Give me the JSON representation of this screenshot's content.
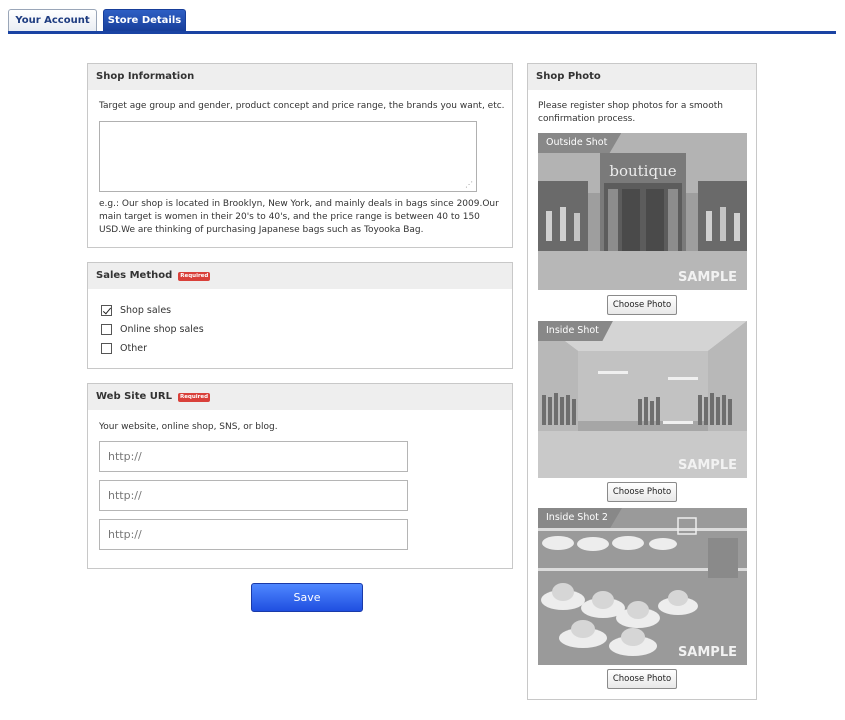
{
  "tabs": {
    "account": "Your Account",
    "store": "Store Details"
  },
  "shop_info": {
    "title": "Shop Information",
    "description": "Target age group and gender, product concept and price range, the brands you want, etc.",
    "textarea_value": "",
    "example": "e.g.: Our shop is located in Brooklyn, New York, and mainly deals in bags since 2009.Our main target is women in their 20's to 40's, and the price range is between 40 to 150 USD.We are thinking of purchasing Japanese bags such as Toyooka Bag."
  },
  "sales_method": {
    "title": "Sales Method",
    "required_badge": "Required",
    "options": [
      {
        "label": "Shop sales",
        "checked": true
      },
      {
        "label": "Online shop sales",
        "checked": false
      },
      {
        "label": "Other",
        "checked": false
      }
    ]
  },
  "website": {
    "title": "Web Site URL",
    "required_badge": "Required",
    "description": "Your website, online shop, SNS, or blog.",
    "placeholders": [
      "http://",
      "http://",
      "http://"
    ]
  },
  "save_label": "Save",
  "shop_photo": {
    "title": "Shop Photo",
    "description": "Please register shop photos for a smooth confirmation process.",
    "photos": [
      {
        "label": "Outside Shot",
        "sign": "boutique",
        "sample": "SAMPLE",
        "button": "Choose Photo"
      },
      {
        "label": "Inside Shot",
        "sample": "SAMPLE",
        "button": "Choose Photo"
      },
      {
        "label": "Inside Shot 2",
        "sample": "SAMPLE",
        "button": "Choose Photo"
      }
    ]
  },
  "colors": {
    "accent": "#1a43a3",
    "required": "#d9403a",
    "save": "#2a5cf0"
  }
}
